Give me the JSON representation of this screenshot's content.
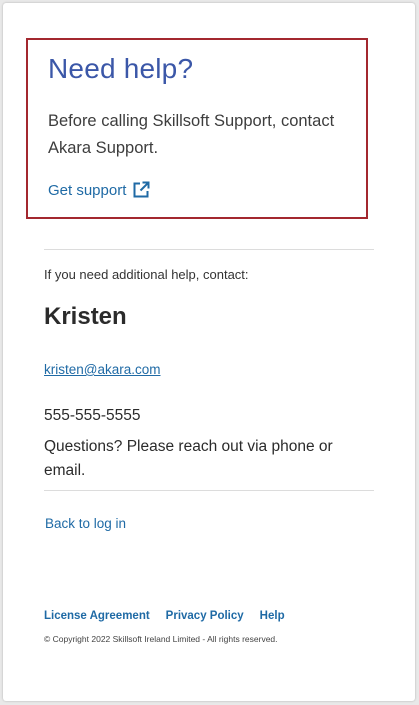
{
  "help": {
    "title": "Need help?",
    "text": "Before calling Skillsoft Support, contact Akara Support.",
    "support_link": "Get support",
    "support_icon": "external-link-icon",
    "border_color": "#a3282f"
  },
  "contact": {
    "intro": "If you need additional help, contact:",
    "name": "Kristen",
    "email": "kristen@akara.com",
    "phone": "555-555-5555",
    "note": "Questions? Please reach out via phone or email."
  },
  "nav": {
    "back": "Back to log in"
  },
  "footer": {
    "links": [
      "License Agreement",
      "Privacy Policy",
      "Help"
    ],
    "copyright": "© Copyright 2022 Skillsoft Ireland Limited - All rights reserved."
  },
  "colors": {
    "link": "#1f6aa5",
    "title": "#3b57a8"
  }
}
